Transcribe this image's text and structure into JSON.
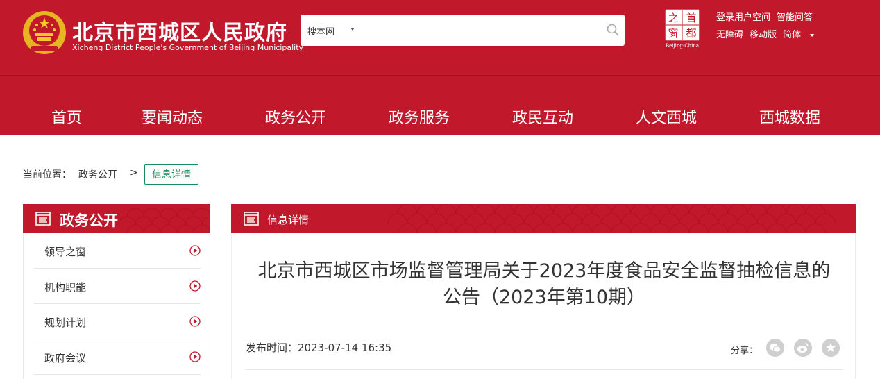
{
  "header": {
    "site_title": "北京市西城区人民政府",
    "site_subtitle": "Xicheng District People's Government of Beijing Municipality",
    "search": {
      "scope": "搜本网",
      "placeholder": ""
    },
    "capital_logo": {
      "chars": [
        "之",
        "首",
        "窗",
        "都"
      ],
      "caption": "Beijing-China"
    },
    "top_links": {
      "row1": [
        "登录用户空间",
        "智能问答"
      ],
      "row2": [
        "无障碍",
        "移动版",
        "简体"
      ]
    },
    "nav": [
      "首页",
      "要闻动态",
      "政务公开",
      "政务服务",
      "政民互动",
      "人文西城",
      "西城数据"
    ]
  },
  "breadcrumb": {
    "label": "当前位置：",
    "link": "政务公开",
    "separator": ">",
    "current": "信息详情"
  },
  "sidebar": {
    "title": "政务公开",
    "items": [
      "领导之窗",
      "机构职能",
      "规划计划",
      "政府会议"
    ]
  },
  "main": {
    "header_title": "信息详情",
    "article_title_line1": "北京市西城区市场监督管理局关于2023年度食品安全监督抽检信息的",
    "article_title_line2": "公告（2023年第10期）",
    "publish_time": "发布时间：2023-07-14 16:35",
    "share_label": "分享："
  },
  "colors": {
    "brand_red": "#c2182b",
    "accent_green": "#1b8a5a",
    "icon_red": "#c2182b",
    "share_gray": "#cfcfcf"
  },
  "icons": {
    "emblem": "national-emblem-icon",
    "search": "search-icon",
    "panel_head": "document-list-icon",
    "side_arrow": "play-circle-icon",
    "share": [
      "wechat-icon",
      "weibo-icon",
      "favorite-star-icon"
    ]
  }
}
